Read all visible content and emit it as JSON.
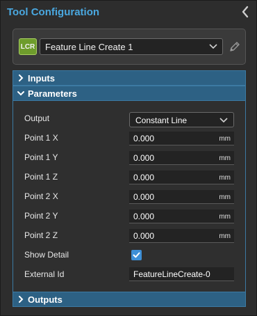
{
  "panel": {
    "title": "Tool Configuration"
  },
  "tool": {
    "badge": "LCR",
    "selected": "Feature Line Create 1"
  },
  "sections": {
    "inputs": "Inputs",
    "parameters": "Parameters",
    "outputs": "Outputs"
  },
  "params": {
    "output": {
      "label": "Output",
      "value": "Constant Line"
    },
    "point1x": {
      "label": "Point 1 X",
      "value": "0.000",
      "unit": "mm"
    },
    "point1y": {
      "label": "Point 1 Y",
      "value": "0.000",
      "unit": "mm"
    },
    "point1z": {
      "label": "Point 1 Z",
      "value": "0.000",
      "unit": "mm"
    },
    "point2x": {
      "label": "Point 2 X",
      "value": "0.000",
      "unit": "mm"
    },
    "point2y": {
      "label": "Point 2 Y",
      "value": "0.000",
      "unit": "mm"
    },
    "point2z": {
      "label": "Point 2 Z",
      "value": "0.000",
      "unit": "mm"
    },
    "show_detail": {
      "label": "Show Detail",
      "checked": true
    },
    "external_id": {
      "label": "External Id",
      "value": "FeatureLineCreate-0"
    }
  },
  "colors": {
    "accent": "#4aa8e0",
    "section_header": "#2d6184",
    "badge": "#6e9c2c",
    "checkbox": "#3d8fd6"
  },
  "icons": [
    "chevron-left-icon",
    "chevron-down-icon",
    "pencil-icon",
    "chevron-right-icon",
    "checkmark-icon"
  ]
}
